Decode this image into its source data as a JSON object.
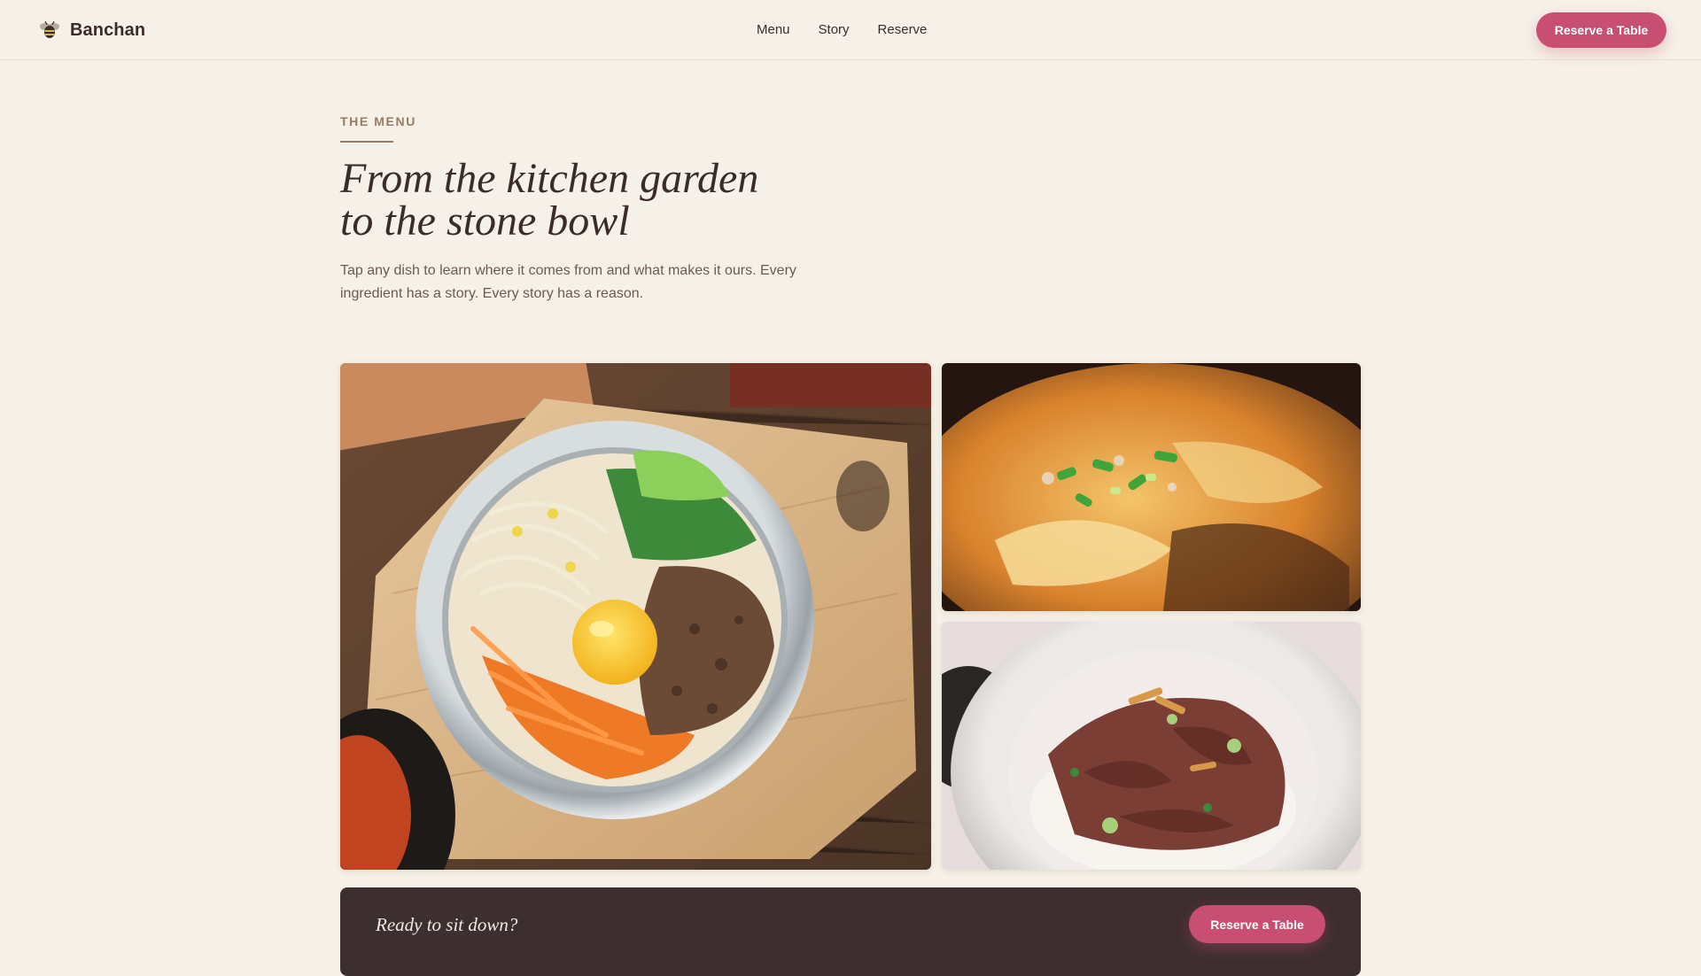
{
  "brand": {
    "name": "Banchan",
    "icon": "bee-icon"
  },
  "nav": {
    "items": [
      {
        "label": "Menu"
      },
      {
        "label": "Story"
      },
      {
        "label": "Reserve"
      }
    ],
    "cta_label": "Reserve a Table"
  },
  "intro": {
    "eyebrow": "THE MENU",
    "headline_line1": "From the kitchen garden",
    "headline_line2": "to the stone bowl",
    "lede": "Tap any dish to learn where it comes from and what makes it ours. Every ingredient has a story. Every story has a reason."
  },
  "gallery": {
    "dishes": [
      {
        "image": "bibimbap-photo"
      },
      {
        "image": "sundubu-stew-photo"
      },
      {
        "image": "bulgogi-rice-bowl-photo"
      }
    ]
  },
  "cta": {
    "text": "Ready to sit down?",
    "button_label": "Reserve a Table"
  },
  "colors": {
    "background": "#f6f1e8",
    "accent": "#c84e72",
    "dark_band": "#3d2e2f",
    "eyebrow": "#9a7a62",
    "text": "#3a2c2a"
  }
}
